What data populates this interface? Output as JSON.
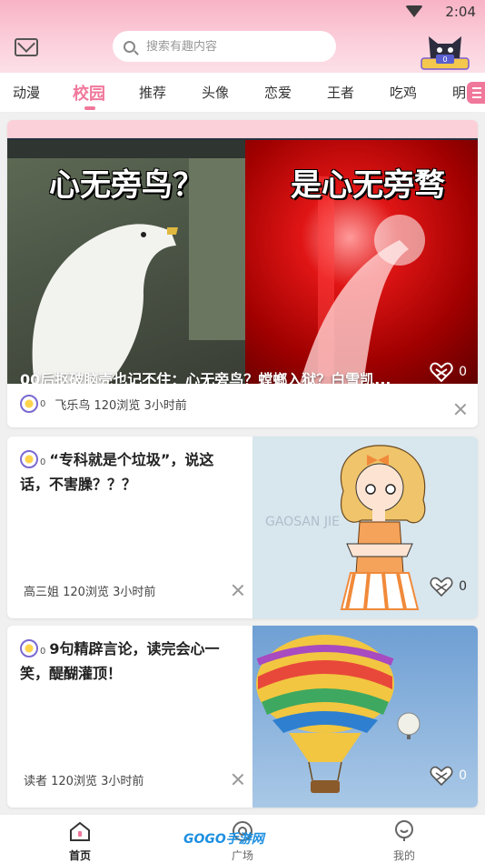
{
  "status_bar": {
    "time": "2:04"
  },
  "header": {
    "search_placeholder": "搜索有趣内容",
    "mascot_badge": "0"
  },
  "tabs": [
    {
      "label": "动漫"
    },
    {
      "label": "校园"
    },
    {
      "label": "推荐"
    },
    {
      "label": "头像"
    },
    {
      "label": "恋爱"
    },
    {
      "label": "王者"
    },
    {
      "label": "吃鸡"
    },
    {
      "label": "明"
    }
  ],
  "active_tab": "校园",
  "feed": [
    {
      "image_text_left": "心无旁鸟？",
      "image_text_right": "是心无旁骛",
      "title": "00后抠破脑壳也记不住：心无旁鸟？螳螂入狱？白雪凯...",
      "likes": "0",
      "badge_num": "0",
      "meta": "飞乐鸟 120浏览 3小时前"
    },
    {
      "badge_num": "0",
      "title": "“专科就是个垃圾”，说这话，不害臊？？？",
      "image_text": "GAOSAN JIE",
      "likes": "0",
      "meta": "高三姐 120浏览 3小时前"
    },
    {
      "badge_num": "0",
      "title": "9句精辟言论，读完会心一笑，醍醐灌顶！",
      "likes": "0",
      "meta": "读者 120浏览 3小时前"
    }
  ],
  "bottom_nav": [
    {
      "label": "首页"
    },
    {
      "label": "广场"
    },
    {
      "label": "我的"
    }
  ],
  "watermark": "GOGO手游网",
  "colors": {
    "accent": "#f0789b",
    "header_pink": "#f8b3c6"
  }
}
